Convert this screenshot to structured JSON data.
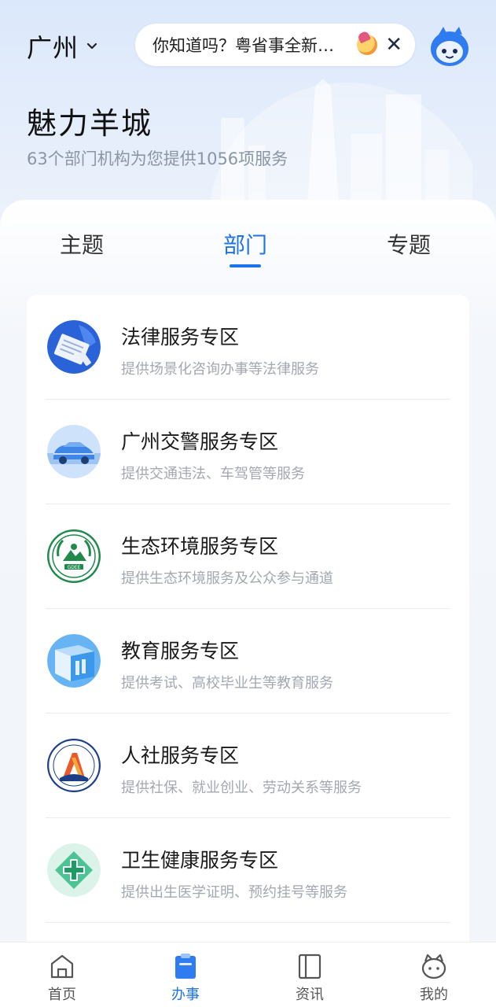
{
  "header": {
    "city": "广州",
    "notice_text": "你知道吗？粤省事全新…",
    "title": "魅力羊城",
    "subtitle": "63个部门机构为您提供1056项服务"
  },
  "tabs": [
    {
      "label": "主题",
      "active": false
    },
    {
      "label": "部门",
      "active": true
    },
    {
      "label": "专题",
      "active": false
    }
  ],
  "services": [
    {
      "title": "法律服务专区",
      "desc": "提供场景化咨询办事等法律服务",
      "icon": "legal-document-icon"
    },
    {
      "title": "广州交警服务专区",
      "desc": "提供交通违法、车驾管等服务",
      "icon": "police-car-icon"
    },
    {
      "title": "生态环境服务专区",
      "desc": "提供生态环境服务及公众参与通道",
      "icon": "gdee-emblem-icon"
    },
    {
      "title": "教育服务专区",
      "desc": "提供考试、高校毕业生等教育服务",
      "icon": "book-icon"
    },
    {
      "title": "人社服务专区",
      "desc": "提供社保、就业创业、劳动关系等服务",
      "icon": "hrss-emblem-icon"
    },
    {
      "title": "卫生健康服务专区",
      "desc": "提供出生医学证明、预约挂号等服务",
      "icon": "medical-cross-icon"
    }
  ],
  "icons": {
    "gdee_text": "GDEE"
  },
  "nav": [
    {
      "label": "首页",
      "icon": "home-icon",
      "active": false
    },
    {
      "label": "办事",
      "icon": "clipboard-icon",
      "active": true
    },
    {
      "label": "资讯",
      "icon": "book-news-icon",
      "active": false
    },
    {
      "label": "我的",
      "icon": "mascot-face-icon",
      "active": false
    }
  ],
  "colors": {
    "accent": "#1e73e8",
    "hero_bg": "#dbe8fb",
    "muted_text": "#a3a8b0"
  }
}
